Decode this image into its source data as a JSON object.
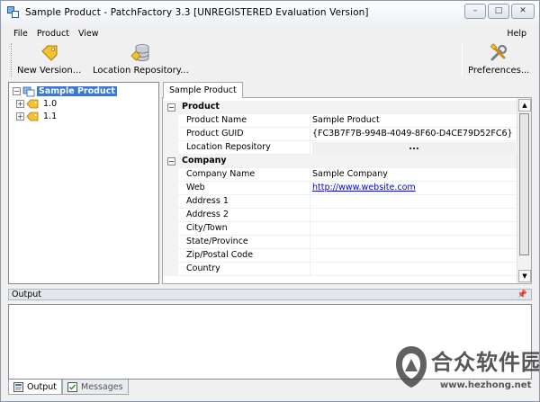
{
  "window": {
    "title": "Sample Product  -  PatchFactory 3.3  [UNREGISTERED Evaluation Version]",
    "minimize": "–",
    "maximize": "□",
    "close": "✕"
  },
  "menu": {
    "file": "File",
    "product": "Product",
    "view": "View",
    "help": "Help"
  },
  "toolbar": {
    "new_version": "New Version...",
    "location_repository": "Location Repository...",
    "preferences": "Preferences..."
  },
  "tree": {
    "root": "Sample Product",
    "children": [
      "1.0",
      "1.1"
    ],
    "collapse_glyph": "−",
    "expand_glyph": "+"
  },
  "properties": {
    "tab": "Sample Product",
    "collapse_glyph": "−",
    "categories": [
      {
        "name": "Product",
        "rows": [
          {
            "name": "Product Name",
            "value": "Sample Product"
          },
          {
            "name": "Product GUID",
            "value": "{FC3B7F7B-994B-4049-8F60-D4CE79D52FC6}"
          },
          {
            "name": "Location Repository",
            "value": "..."
          }
        ]
      },
      {
        "name": "Company",
        "rows": [
          {
            "name": "Company Name",
            "value": "Sample Company"
          },
          {
            "name": "Web",
            "value": "http://www.website.com"
          },
          {
            "name": "Address 1",
            "value": ""
          },
          {
            "name": "Address 2",
            "value": ""
          },
          {
            "name": "City/Town",
            "value": ""
          },
          {
            "name": "State/Province",
            "value": ""
          },
          {
            "name": "Zip/Postal Code",
            "value": ""
          },
          {
            "name": "Country",
            "value": ""
          }
        ]
      }
    ]
  },
  "output": {
    "header": "Output",
    "pin": "📌",
    "tabs": [
      "Output",
      "Messages"
    ]
  },
  "watermark": {
    "text": "合众软件园",
    "url": "www.hezhong.net"
  },
  "colors": {
    "selection": "#3a78d6",
    "link": "#0000ee",
    "tag_icon": "#e8b020"
  }
}
